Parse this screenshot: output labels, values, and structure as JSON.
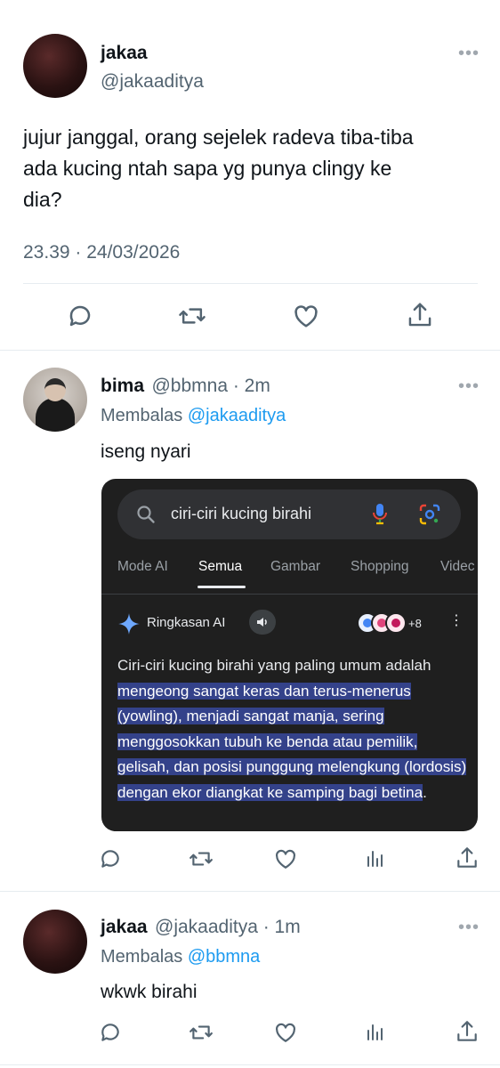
{
  "main_tweet": {
    "name": "jakaa",
    "handle": "@jakaaditya",
    "text_lines": [
      "jujur janggal, orang sejelek radeva tiba-tiba",
      "ada kucing ntah sapa yg punya clingy ke",
      "dia?"
    ],
    "timestamp": "23.39 · 24/03/2026"
  },
  "reply1": {
    "name": "bima",
    "handle_time": "@bbmna · 2m",
    "replying_prefix": "Membalas",
    "replying_to": "@jakaaditya",
    "text": "iseng nyari",
    "embedded": {
      "search_query": "ciri-ciri kucing birahi",
      "tabs": [
        "Mode AI",
        "Semua",
        "Gambar",
        "Shopping",
        "Videc"
      ],
      "active_tab": "Semua",
      "ai_overview_title": "Ringkasan AI",
      "sources_more": "+8",
      "ai_text_plain": "Ciri-ciri kucing birahi yang paling umum adalah",
      "ai_text_highlight": "mengeong sangat keras dan terus-menerus (yowling), menjadi sangat manja, sering menggosokkan tubuh ke benda atau pemilik, gelisah, dan posisi punggung melengkung (lordosis) dengan ekor diangkat ke samping bagi betina",
      "ai_text_end": "."
    }
  },
  "reply2": {
    "name": "jakaa",
    "handle_time": "@jakaaditya · 1m",
    "replying_prefix": "Membalas",
    "replying_to": "@bbmna",
    "text": "wkwk birahi"
  },
  "colors": {
    "link": "#1d9bf0",
    "muted": "#536471",
    "highlight": "#34428a"
  },
  "icons": [
    "reply-icon",
    "retweet-icon",
    "like-icon",
    "share-icon",
    "views-icon",
    "more-icon",
    "search-icon",
    "mic-icon",
    "lens-icon",
    "sparkle-icon",
    "speaker-icon"
  ]
}
